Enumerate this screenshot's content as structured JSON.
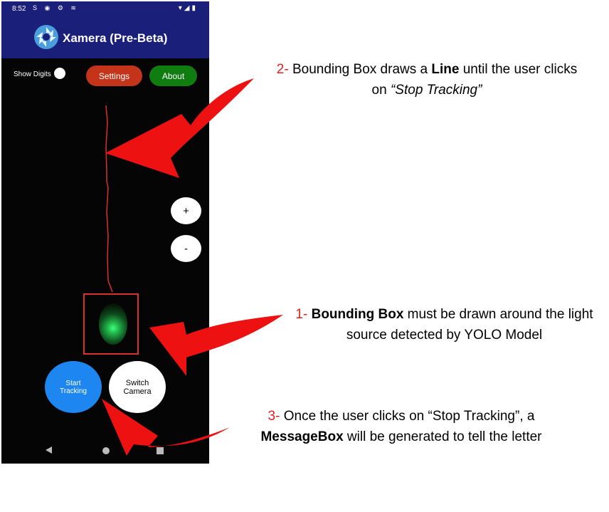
{
  "status_bar": {
    "time": "8:52",
    "left_icons": "S ◉ ⚙ ≋",
    "right_icons": "▾◢▮"
  },
  "app": {
    "title": "Xamera (Pre-Beta)"
  },
  "controls": {
    "show_digits_label": "Show Digits",
    "settings_label": "Settings",
    "about_label": "About",
    "zoom_in_label": "+",
    "zoom_out_label": "-",
    "start_tracking_label": "Start\nTracking",
    "switch_camera_label": "Switch\nCamera"
  },
  "annotations": {
    "a2": {
      "num": "2-",
      "t1": " Bounding Box draws a ",
      "b1": "Line",
      "t2": " until the user clicks on ",
      "i1": "“Stop Tracking”"
    },
    "a1": {
      "num": "1-",
      "t0": " ",
      "b1": "Bounding Box",
      "t1": " must be drawn around the light source detected by YOLO Model"
    },
    "a3": {
      "num": "3-",
      "t1": " Once the user clicks on “Stop Tracking”, a ",
      "b1": "MessageBox",
      "t2": " will be generated to tell the letter"
    }
  },
  "colors": {
    "app_bar": "#1a1f7a",
    "settings": "#c4341b",
    "about": "#0f7d0f",
    "start": "#1e86f0",
    "arrow": "#ee1111",
    "trace": "#d8302a"
  }
}
